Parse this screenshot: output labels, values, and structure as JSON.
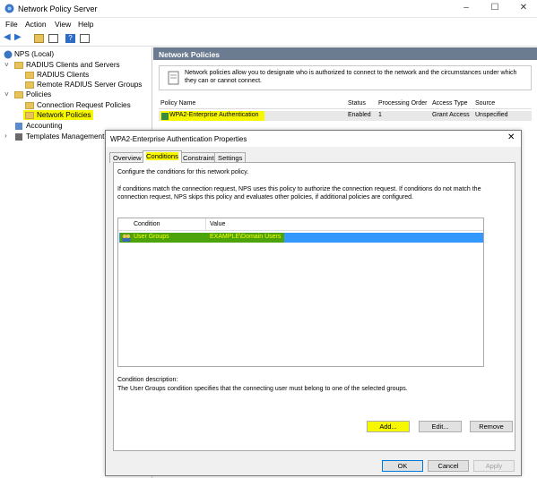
{
  "window": {
    "title": "Network Policy Server"
  },
  "menu": [
    "File",
    "Action",
    "View",
    "Help"
  ],
  "tree": {
    "root": "NPS (Local)",
    "radius": "RADIUS Clients and Servers",
    "radius_clients": "RADIUS Clients",
    "remote_groups": "Remote RADIUS Server Groups",
    "policies": "Policies",
    "conn_req": "Connection Request Policies",
    "net_policies": "Network Policies",
    "accounting": "Accounting",
    "templates": "Templates Management"
  },
  "pane": {
    "header": "Network Policies",
    "info": "Network policies allow you to designate who is authorized to connect to the network and the circumstances under which they can or cannot connect.",
    "columns": [
      "Policy Name",
      "Status",
      "Processing Order",
      "Access Type",
      "Source"
    ],
    "row": {
      "name": "WPA2-Enterprise Authentication",
      "status": "Enabled",
      "order": "1",
      "access": "Grant Access",
      "source": "Unspecified"
    }
  },
  "dialog": {
    "title": "WPA2-Enterprise Authentication Properties",
    "tabs": [
      "Overview",
      "Conditions",
      "Constraints",
      "Settings"
    ],
    "intro": "Configure the conditions for this network policy.",
    "para": "If conditions match the connection request, NPS uses this policy to authorize the connection request. If conditions do not match the connection request, NPS skips this policy and evaluates other policies, if additional policies are configured.",
    "columns": [
      "Condition",
      "Value"
    ],
    "cond_row": {
      "condition": "User Groups",
      "value": "EXAMPLE\\Domain Users"
    },
    "desc_label": "Condition description:",
    "desc_text": "The User Groups condition specifies that the connecting user must belong to one of the selected groups.",
    "add": "Add...",
    "edit": "Edit...",
    "remove": "Remove",
    "ok": "OK",
    "cancel": "Cancel",
    "apply": "Apply"
  },
  "colors": {
    "highlight": "#f7f700",
    "selection": "#3399ff",
    "header": "#6b7b90"
  }
}
